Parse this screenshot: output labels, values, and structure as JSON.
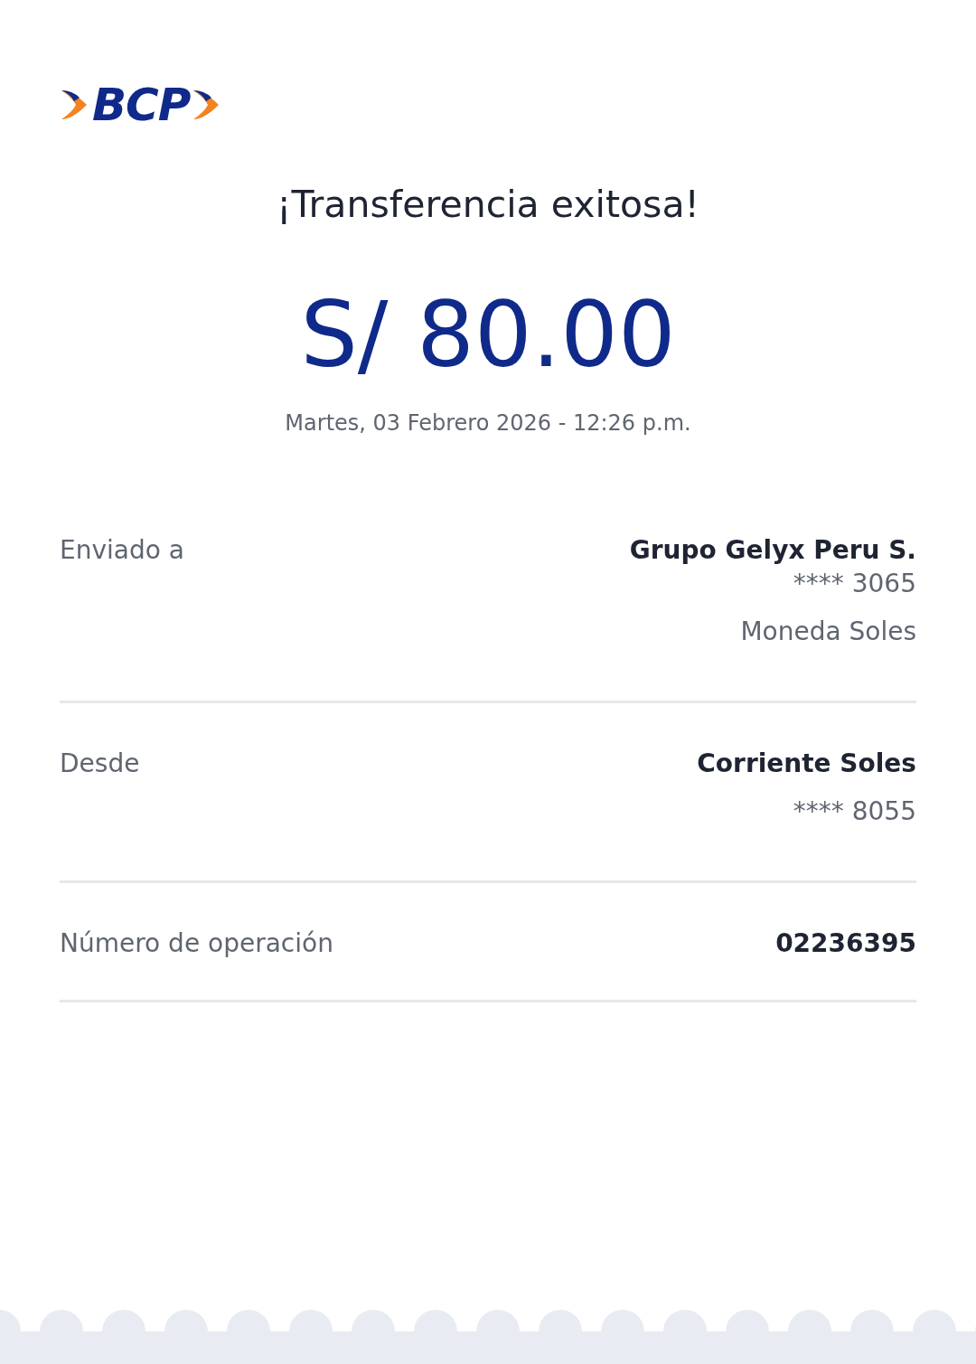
{
  "logo": {
    "text": "BCP"
  },
  "title": "¡Transferencia exitosa!",
  "amount": "S/ 80.00",
  "datetime": "Martes, 03 Febrero 2026 - 12:26 p.m.",
  "details": [
    {
      "label": "Enviado a",
      "values": [
        {
          "kind": "primary",
          "text": "Grupo Gelyx Peru S."
        },
        {
          "kind": "secondary",
          "text": "**** 3065"
        },
        {
          "kind": "extra",
          "text": "Moneda Soles"
        }
      ]
    },
    {
      "label": "Desde",
      "values": [
        {
          "kind": "primary",
          "text": "Corriente Soles"
        },
        {
          "kind": "extra",
          "text": "**** 8055"
        }
      ]
    },
    {
      "label": "Número de operación",
      "values": [
        {
          "kind": "primary",
          "text": "02236395"
        }
      ]
    }
  ]
}
